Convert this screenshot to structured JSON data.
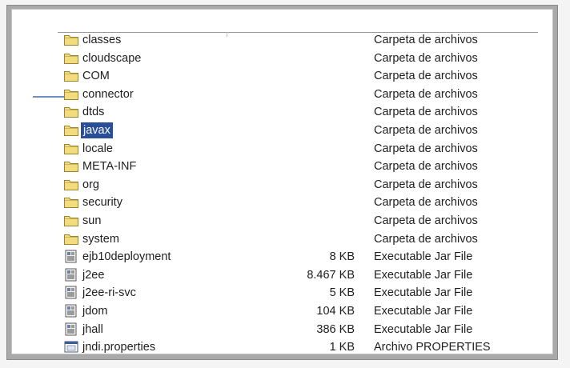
{
  "window": {
    "title": ""
  },
  "files": [
    {
      "name": "classes",
      "size": "",
      "type": "Carpeta de archivos",
      "icon": "folder-icon"
    },
    {
      "name": "cloudscape",
      "size": "",
      "type": "Carpeta de archivos",
      "icon": "folder-icon"
    },
    {
      "name": "COM",
      "size": "",
      "type": "Carpeta de archivos",
      "icon": "folder-icon"
    },
    {
      "name": "connector",
      "size": "",
      "type": "Carpeta de archivos",
      "icon": "folder-icon"
    },
    {
      "name": "dtds",
      "size": "",
      "type": "Carpeta de archivos",
      "icon": "folder-icon"
    },
    {
      "name": "javax",
      "size": "",
      "type": "Carpeta de archivos",
      "icon": "folder-icon",
      "selected": true
    },
    {
      "name": "locale",
      "size": "",
      "type": "Carpeta de archivos",
      "icon": "folder-icon"
    },
    {
      "name": "META-INF",
      "size": "",
      "type": "Carpeta de archivos",
      "icon": "folder-icon"
    },
    {
      "name": "org",
      "size": "",
      "type": "Carpeta de archivos",
      "icon": "folder-icon"
    },
    {
      "name": "security",
      "size": "",
      "type": "Carpeta de archivos",
      "icon": "folder-icon"
    },
    {
      "name": "sun",
      "size": "",
      "type": "Carpeta de archivos",
      "icon": "folder-icon"
    },
    {
      "name": "system",
      "size": "",
      "type": "Carpeta de archivos",
      "icon": "folder-icon"
    },
    {
      "name": "ejb10deployment",
      "size": "8 KB",
      "type": "Executable Jar File",
      "icon": "jar-file-icon"
    },
    {
      "name": "j2ee",
      "size": "8.467 KB",
      "type": "Executable Jar File",
      "icon": "jar-file-icon"
    },
    {
      "name": "j2ee-ri-svc",
      "size": "5 KB",
      "type": "Executable Jar File",
      "icon": "jar-file-icon"
    },
    {
      "name": "jdom",
      "size": "104 KB",
      "type": "Executable Jar File",
      "icon": "jar-file-icon"
    },
    {
      "name": "jhall",
      "size": "386 KB",
      "type": "Executable Jar File",
      "icon": "jar-file-icon"
    },
    {
      "name": "jndi.properties",
      "size": "1 KB",
      "type": "Archivo PROPERTIES",
      "icon": "properties-file-icon"
    }
  ],
  "colors": {
    "selection": "#2a4f98",
    "folder_fill": "#f3dc7e",
    "folder_stroke": "#9e8431"
  }
}
